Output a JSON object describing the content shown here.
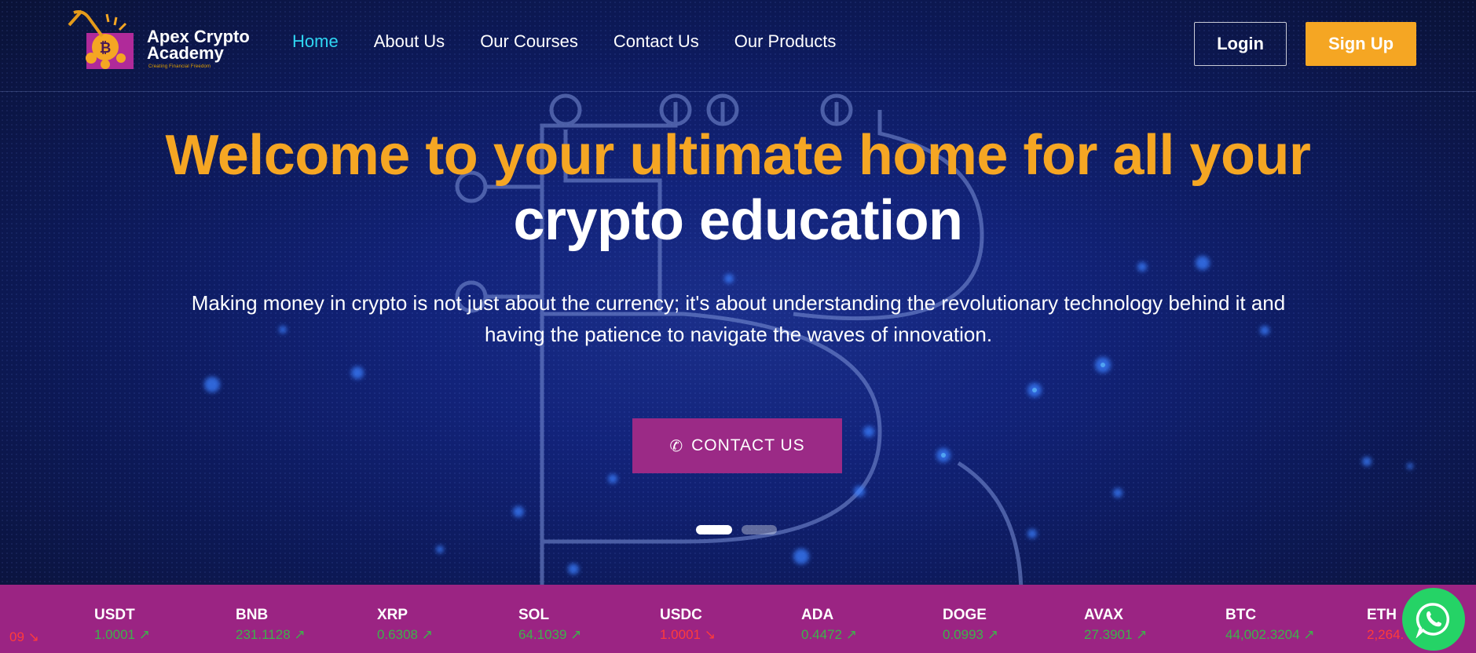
{
  "brand": {
    "name_line1": "Apex Crypto",
    "name_line2": "Academy",
    "tagline": "Creating Financial Freedom",
    "accent": "#f5a623",
    "purple": "#9b2a86",
    "nav_active": "#2fd6f2"
  },
  "nav": {
    "items": [
      {
        "label": "Home",
        "active": true
      },
      {
        "label": "About Us"
      },
      {
        "label": "Our Courses"
      },
      {
        "label": "Contact Us"
      },
      {
        "label": "Our Products"
      }
    ]
  },
  "auth": {
    "login": "Login",
    "signup": "Sign Up"
  },
  "hero": {
    "title_line1": "Welcome to your ultimate home for all your",
    "title_line2": "crypto education",
    "subtitle_line1": "Making money in crypto is not just about the currency; it's about understanding the revolutionary technology behind it and",
    "subtitle_line2": "having the patience to navigate the waves of innovation.",
    "cta": "CONTACT US",
    "cta_icon": "phone-icon",
    "slides": 2,
    "active_slide": 1
  },
  "ticker": {
    "partial_left": {
      "value": "09 ↘",
      "trend": "down"
    },
    "items": [
      {
        "symbol": "USDT",
        "value": "1.0001 ↗",
        "trend": "up"
      },
      {
        "symbol": "BNB",
        "value": "231.1128 ↗",
        "trend": "up"
      },
      {
        "symbol": "XRP",
        "value": "0.6308 ↗",
        "trend": "up"
      },
      {
        "symbol": "SOL",
        "value": "64.1039 ↗",
        "trend": "up"
      },
      {
        "symbol": "USDC",
        "value": "1.0001 ↘",
        "trend": "down"
      },
      {
        "symbol": "ADA",
        "value": "0.4472 ↗",
        "trend": "up"
      },
      {
        "symbol": "DOGE",
        "value": "0.0993 ↗",
        "trend": "up"
      },
      {
        "symbol": "AVAX",
        "value": "27.3901 ↗",
        "trend": "up"
      },
      {
        "symbol": "BTC",
        "value": "44,002.3204 ↗",
        "trend": "up"
      },
      {
        "symbol": "ETH",
        "value": "2,264.",
        "trend": "down"
      }
    ]
  },
  "whatsapp": {
    "icon": "whatsapp-icon"
  }
}
